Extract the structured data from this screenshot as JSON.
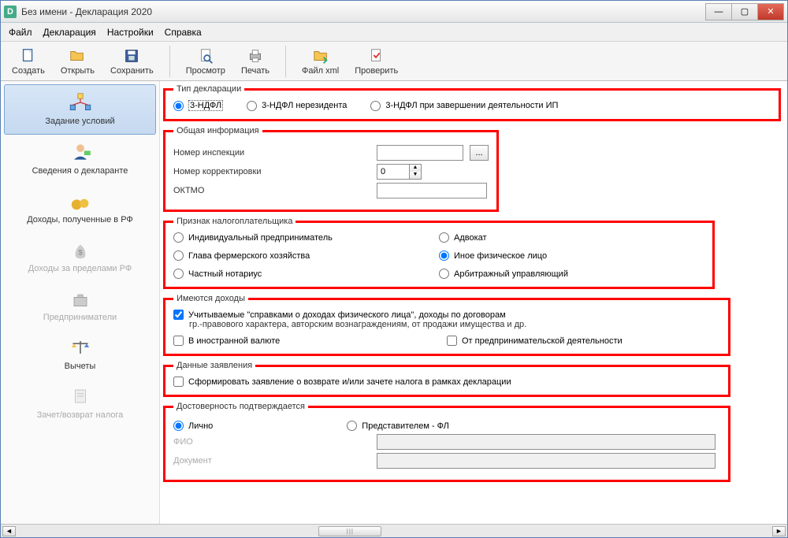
{
  "window": {
    "title": "Без имени - Декларация 2020"
  },
  "menu": [
    "Файл",
    "Декларация",
    "Настройки",
    "Справка"
  ],
  "toolbar": {
    "create": "Создать",
    "open": "Открыть",
    "save": "Сохранить",
    "preview": "Просмотр",
    "print": "Печать",
    "filexml": "Файл xml",
    "check": "Проверить"
  },
  "sidebar": {
    "conditions": "Задание условий",
    "declarant": "Сведения о декларанте",
    "income_rf": "Доходы, полученные в РФ",
    "income_abroad": "Доходы за пределами РФ",
    "entrepreneurs": "Предприниматели",
    "deductions": "Вычеты",
    "refund": "Зачет/возврат налога"
  },
  "form": {
    "decl_type": {
      "legend": "Тип декларации",
      "opt1": "3-НДФЛ",
      "opt2": "3-НДФЛ нерезидента",
      "opt3": "3-НДФЛ при завершении деятельности ИП"
    },
    "general": {
      "legend": "Общая информация",
      "inspection_label": "Номер инспекции",
      "inspection_value": "",
      "correction_label": "Номер корректировки",
      "correction_value": "0",
      "oktmo_label": "ОКТМО",
      "oktmo_value": ""
    },
    "taxpayer": {
      "legend": "Признак налогоплательщика",
      "ip": "Индивидуальный предприниматель",
      "farmer": "Глава фермерского хозяйства",
      "notary": "Частный нотариус",
      "lawyer": "Адвокат",
      "other": "Иное физическое лицо",
      "arbiter": "Арбитражный управляющий"
    },
    "income": {
      "legend": "Имеются доходы",
      "check1": "Учитываемые \"справками о доходах физического лица\", доходы по договорам",
      "check1_sub": "гр.-правового характера, авторским вознаграждениям, от продажи имущества и др.",
      "check2": "В иностранной валюте",
      "check3": "От предпринимательской деятельности"
    },
    "appl": {
      "legend": "Данные заявления",
      "check1": "Сформировать заявление о  возврате и/или зачете налога в рамках декларации"
    },
    "trust": {
      "legend": "Достоверность подтверждается",
      "personal": "Лично",
      "rep": "Представителем - ФЛ",
      "fio_label": "ФИО",
      "fio_value": "",
      "doc_label": "Документ",
      "doc_value": ""
    }
  }
}
